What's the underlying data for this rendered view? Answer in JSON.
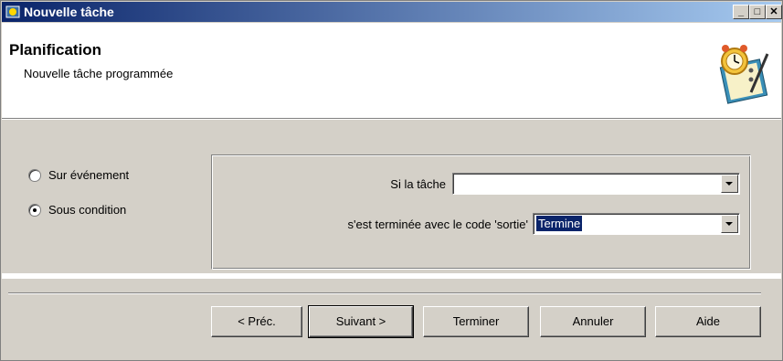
{
  "window": {
    "title": "Nouvelle tâche",
    "controls": {
      "minimize": "_",
      "maximize": "□",
      "close": "✕"
    }
  },
  "header": {
    "title": "Planification",
    "subtitle": "Nouvelle tâche programmée",
    "image_icon": "scheduler-clock-notebook-icon"
  },
  "trigger": {
    "options": [
      {
        "label": "Sur événement",
        "selected": false
      },
      {
        "label": "Sous condition",
        "selected": true
      }
    ]
  },
  "condition": {
    "task_label": "Si la tâche",
    "task_value": "",
    "exit_label": "s'est terminée avec le code 'sortie'",
    "exit_value": "Termine"
  },
  "buttons": {
    "prev": "< Préc.",
    "next": "Suivant >",
    "finish": "Terminer",
    "cancel": "Annuler",
    "help": "Aide"
  },
  "colors": {
    "titlebar_start": "#0a246a",
    "titlebar_end": "#a6caf0",
    "face": "#d4d0c8",
    "selection": "#0a246a"
  }
}
